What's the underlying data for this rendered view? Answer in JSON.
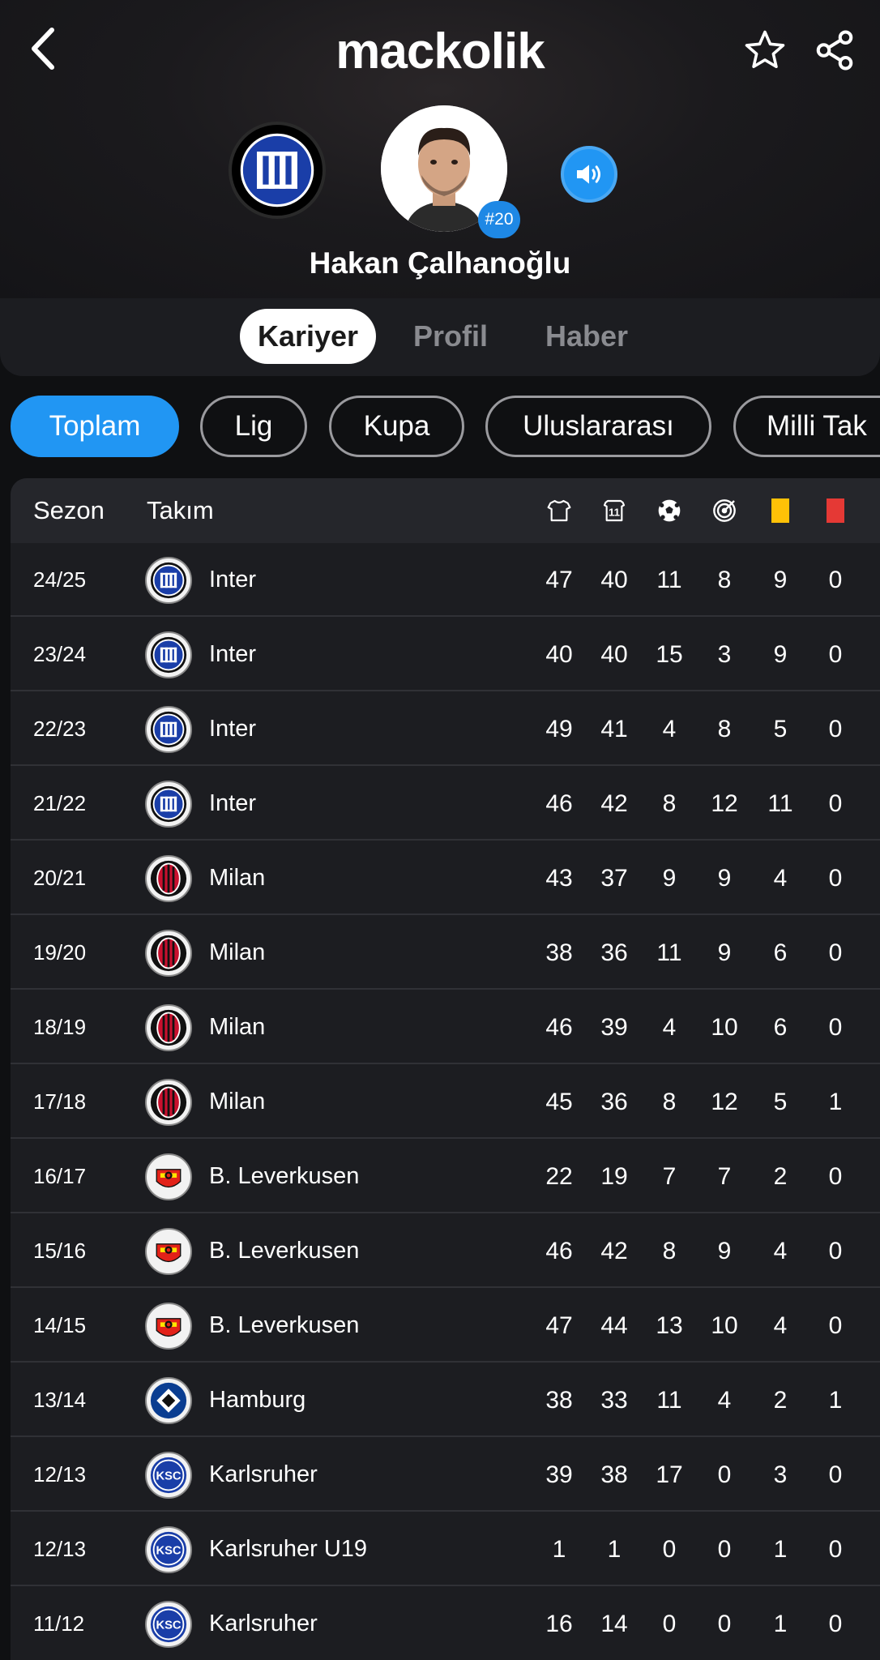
{
  "header": {
    "logo_text": "mackolik",
    "player_name": "Hakan Çalhanoğlu",
    "shirt_number": "#20"
  },
  "tabs": [
    {
      "label": "Kariyer",
      "active": true
    },
    {
      "label": "Profil",
      "active": false
    },
    {
      "label": "Haber",
      "active": false
    }
  ],
  "filters": [
    {
      "label": "Toplam",
      "active": true
    },
    {
      "label": "Lig",
      "active": false
    },
    {
      "label": "Kupa",
      "active": false
    },
    {
      "label": "Uluslararası",
      "active": false
    },
    {
      "label": "Milli Tak",
      "active": false
    }
  ],
  "table": {
    "headers": {
      "season": "Sezon",
      "team": "Takım",
      "icons": [
        "shirt-icon",
        "lineup-11-icon",
        "ball-icon",
        "target-icon",
        "yellow-card-icon",
        "red-card-icon"
      ]
    },
    "colors": {
      "yellow_card": "#ffc107",
      "red_card": "#e53935",
      "accent": "#2196f3"
    },
    "rows": [
      {
        "season": "24/25",
        "team": "Inter",
        "club": "inter",
        "stats": [
          "47",
          "40",
          "11",
          "8",
          "9",
          "0"
        ]
      },
      {
        "season": "23/24",
        "team": "Inter",
        "club": "inter",
        "stats": [
          "40",
          "40",
          "15",
          "3",
          "9",
          "0"
        ]
      },
      {
        "season": "22/23",
        "team": "Inter",
        "club": "inter",
        "stats": [
          "49",
          "41",
          "4",
          "8",
          "5",
          "0"
        ]
      },
      {
        "season": "21/22",
        "team": "Inter",
        "club": "inter",
        "stats": [
          "46",
          "42",
          "8",
          "12",
          "11",
          "0"
        ]
      },
      {
        "season": "20/21",
        "team": "Milan",
        "club": "milan",
        "stats": [
          "43",
          "37",
          "9",
          "9",
          "4",
          "0"
        ]
      },
      {
        "season": "19/20",
        "team": "Milan",
        "club": "milan",
        "stats": [
          "38",
          "36",
          "11",
          "9",
          "6",
          "0"
        ]
      },
      {
        "season": "18/19",
        "team": "Milan",
        "club": "milan",
        "stats": [
          "46",
          "39",
          "4",
          "10",
          "6",
          "0"
        ]
      },
      {
        "season": "17/18",
        "team": "Milan",
        "club": "milan",
        "stats": [
          "45",
          "36",
          "8",
          "12",
          "5",
          "1"
        ]
      },
      {
        "season": "16/17",
        "team": "B. Leverkusen",
        "club": "leverkusen",
        "stats": [
          "22",
          "19",
          "7",
          "7",
          "2",
          "0"
        ]
      },
      {
        "season": "15/16",
        "team": "B. Leverkusen",
        "club": "leverkusen",
        "stats": [
          "46",
          "42",
          "8",
          "9",
          "4",
          "0"
        ]
      },
      {
        "season": "14/15",
        "team": "B. Leverkusen",
        "club": "leverkusen",
        "stats": [
          "47",
          "44",
          "13",
          "10",
          "4",
          "0"
        ]
      },
      {
        "season": "13/14",
        "team": "Hamburg",
        "club": "hamburg",
        "stats": [
          "38",
          "33",
          "11",
          "4",
          "2",
          "1"
        ]
      },
      {
        "season": "12/13",
        "team": "Karlsruher",
        "club": "karlsruher",
        "stats": [
          "39",
          "38",
          "17",
          "0",
          "3",
          "0"
        ]
      },
      {
        "season": "12/13",
        "team": "Karlsruher U19",
        "club": "karlsruher",
        "stats": [
          "1",
          "1",
          "0",
          "0",
          "1",
          "0"
        ]
      },
      {
        "season": "11/12",
        "team": "Karlsruher",
        "club": "karlsruher",
        "stats": [
          "16",
          "14",
          "0",
          "0",
          "1",
          "0"
        ]
      }
    ]
  }
}
